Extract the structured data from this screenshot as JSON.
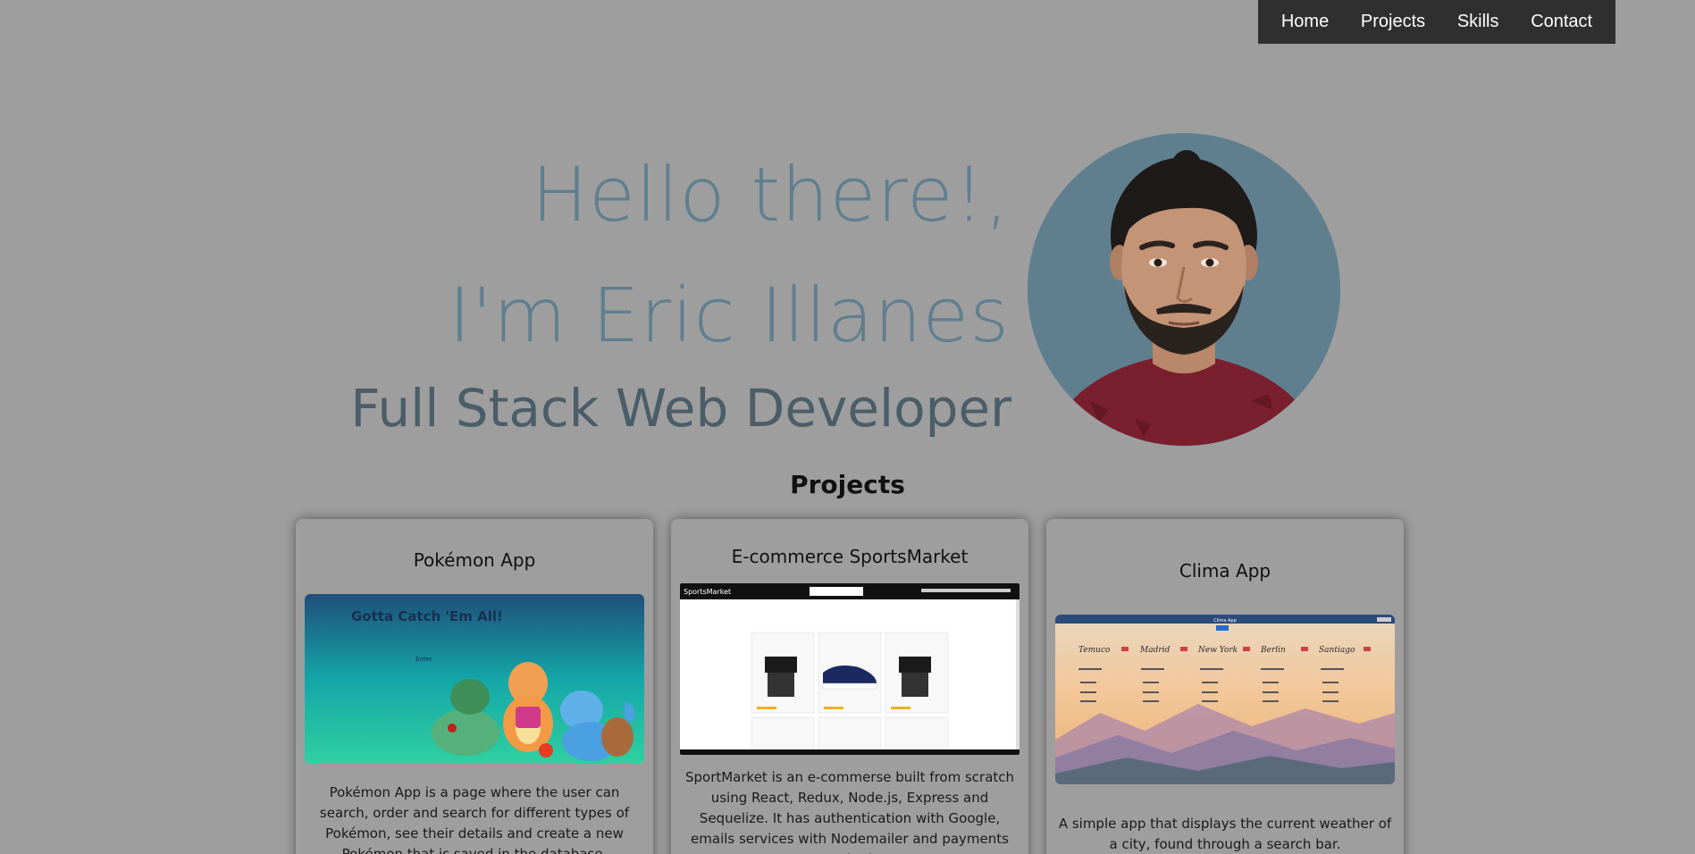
{
  "nav": {
    "items": [
      {
        "label": "Home"
      },
      {
        "label": "Projects"
      },
      {
        "label": "Skills"
      },
      {
        "label": "Contact"
      }
    ]
  },
  "hero": {
    "greeting": "Hello there!,",
    "name_line": "I'm Eric Illanes",
    "subtitle": "Full Stack Web Developer"
  },
  "projects": {
    "heading": "Projects",
    "cards": [
      {
        "title": "Pokémon App",
        "image_text": "Gotta Catch 'Em All!",
        "image_button": "Enter",
        "description": "Pokémon App is a page where the user can search, order and search for different types of Pokémon, see their details and create a new Pokémon that is saved in the database."
      },
      {
        "title": "E-commerce SportsMarket",
        "image_brand": "SportsMarket",
        "description": "SportMarket is an e-commerse built from scratch using React, Redux, Node.js, Express and Sequelize. It has authentication with Google, emails services with Nodemailer and payments methods"
      },
      {
        "title": "Clima App",
        "image_header": "Clima App",
        "image_cities": [
          "Temuco",
          "Madrid",
          "New York",
          "Berlin",
          "Santiago"
        ],
        "description": "A simple app that displays the current weather of a city, found through a search bar."
      }
    ]
  },
  "colors": {
    "background": "#9e9e9e",
    "navbar": "#2f2f2f",
    "hero_text": "#5f7f8f",
    "subtitle_text": "#4a5d68",
    "avatar_bg": "#5f7f8f"
  },
  "icons": {
    "avatar": "profile-photo"
  }
}
